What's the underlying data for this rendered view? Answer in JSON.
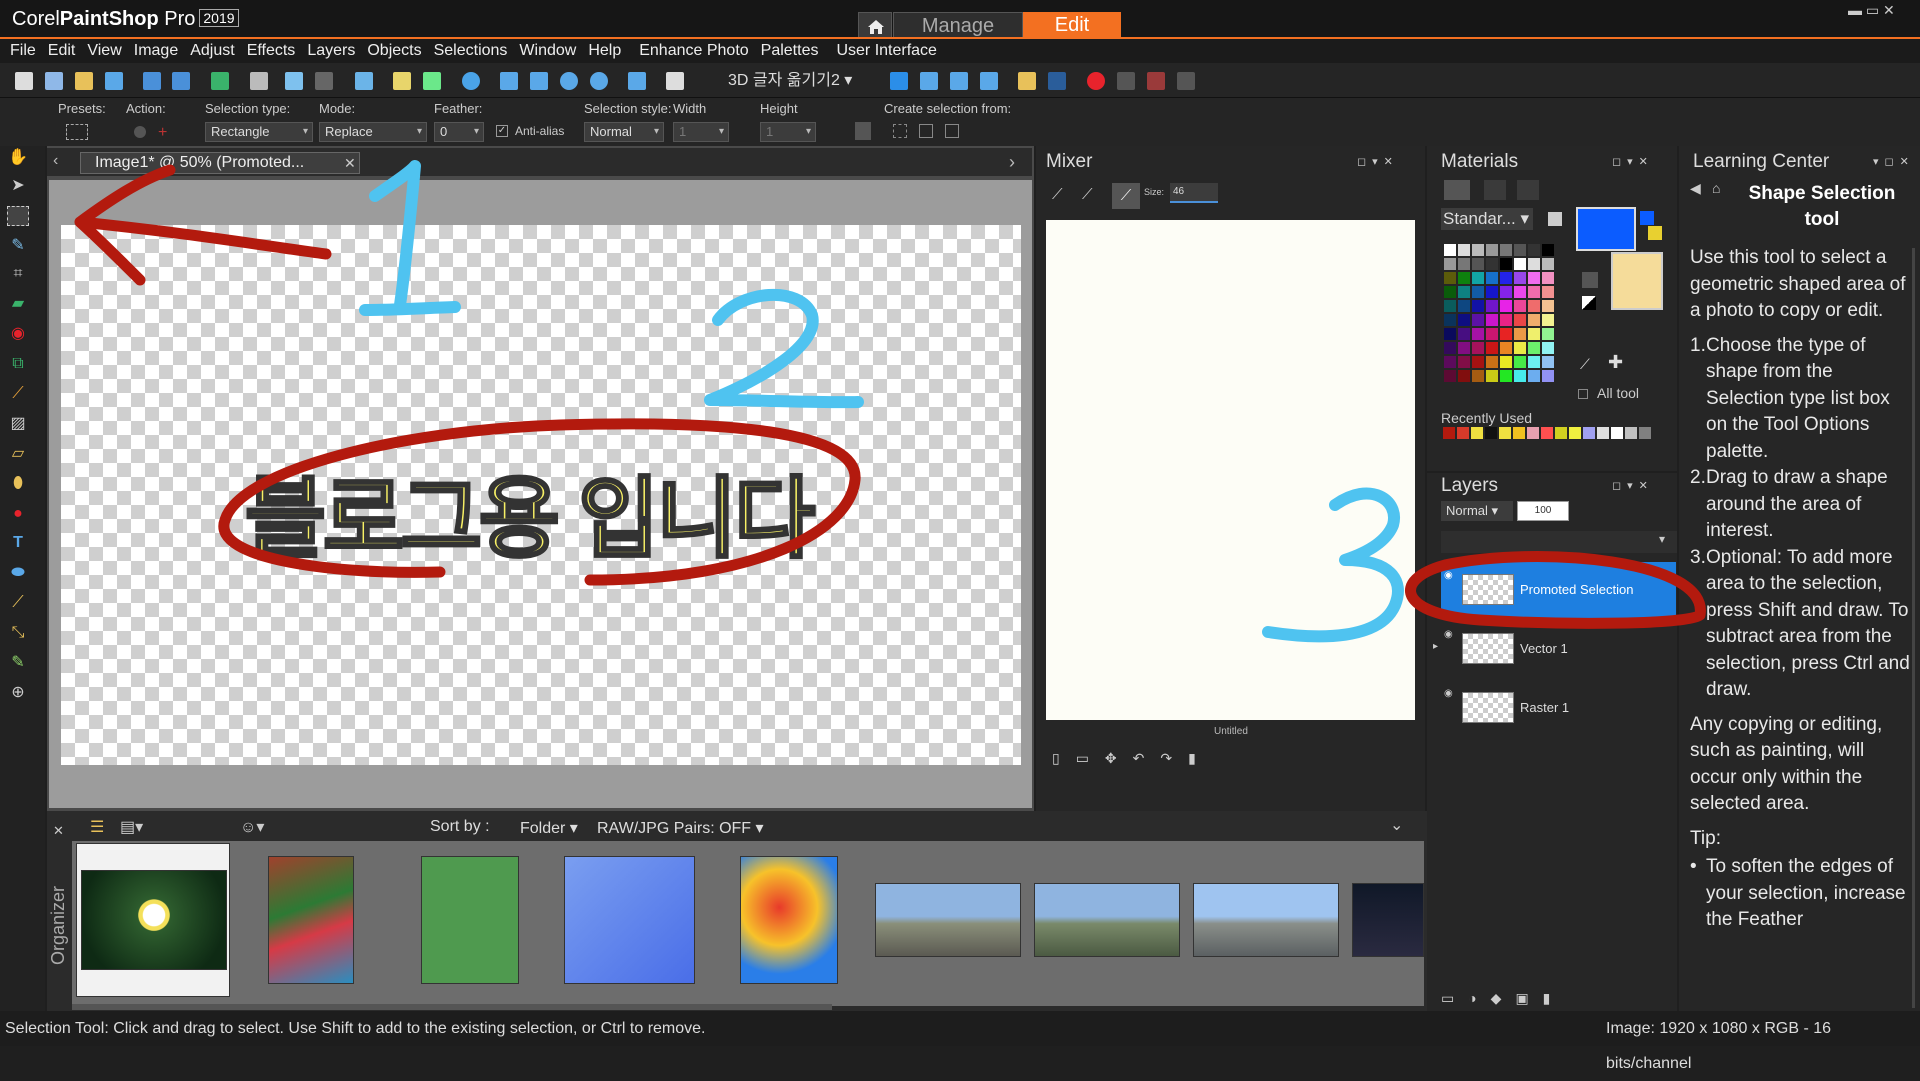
{
  "app": {
    "logo_brand": "Corel",
    "logo_product": "PaintShop",
    "logo_suffix": " Pro",
    "version": "2019",
    "tabs": {
      "manage": "Manage",
      "edit": "Edit"
    },
    "window_controls": "▬  ▭  ✕"
  },
  "menu": [
    "File",
    "Edit",
    "View",
    "Image",
    "Adjust",
    "Effects",
    "Layers",
    "Objects",
    "Selections",
    "Window",
    "Help",
    "Enhance Photo",
    "Palettes",
    "User Interface"
  ],
  "toolbar": {
    "workspace_select": "3D 글자 옮기기2"
  },
  "options": {
    "presets_label": "Presets:",
    "action_label": "Action:",
    "selection_type_label": "Selection type:",
    "selection_type_value": "Rectangle",
    "mode_label": "Mode:",
    "mode_value": "Replace",
    "feather_label": "Feather:",
    "feather_value": "0",
    "antialias_label": "Anti-alias",
    "selection_style_label": "Selection style:",
    "selection_style_value": "Normal",
    "width_label": "Width",
    "width_value": "1",
    "height_label": "Height",
    "height_value": "1",
    "create_from_label": "Create selection from:"
  },
  "document": {
    "tab_title": "Image1* @  50% (Promoted...",
    "canvas_text": "블로그용 입니다",
    "annotations": [
      "1",
      "2",
      "3"
    ]
  },
  "mixer": {
    "title": "Mixer",
    "size_label": "Size:",
    "size_value": "46",
    "paper_label": "Untitled"
  },
  "materials": {
    "title": "Materials",
    "palette_select": "Standar...",
    "all_tools_label": "All tool",
    "recently_used_label": "Recently Used",
    "foreground_color": "#0b5cff",
    "background_color": "#f5dc9a"
  },
  "layers": {
    "title": "Layers",
    "blend_mode": "Normal",
    "opacity": "100",
    "items": [
      {
        "name": "Promoted Selection",
        "selected": true
      },
      {
        "name": "Vector 1",
        "selected": false
      },
      {
        "name": "Raster 1",
        "selected": false
      }
    ]
  },
  "learning_center": {
    "title": "Learning Center",
    "tool_title": "Shape Selection tool",
    "intro": "Use this tool to select a geometric shaped area of a photo to copy or edit.",
    "steps": [
      {
        "num": "1.",
        "text": "Choose the type of shape from the Selection type list box on the Tool Options palette."
      },
      {
        "num": "2.",
        "text": "Drag to draw a shape around the area of interest."
      },
      {
        "num": "3.",
        "text": "Optional: To add more area to the selection, press Shift and draw. To subtract area from the selection, press Ctrl and draw."
      }
    ],
    "note": "Any copying or editing, such as painting, will occur only within the selected area.",
    "tip_label": "Tip:",
    "tip_text": "To soften the edges of your selection, increase the Feather"
  },
  "organizer": {
    "label": "Organizer",
    "sort_label": "Sort by :",
    "sort_value": "Folder",
    "raw_pairs": "RAW/JPG Pairs: OFF"
  },
  "status": {
    "message": "Selection Tool: Click and drag to select. Use Shift to add to the existing selection, or Ctrl to remove.",
    "image_info": "Image:  1920 x 1080 x RGB - 16 bits/channel"
  },
  "colors": {
    "accent": "#f37021",
    "annotation_red": "#b31a0e",
    "annotation_blue": "#4fc3f0",
    "layer_selected": "#1e7fe0"
  }
}
